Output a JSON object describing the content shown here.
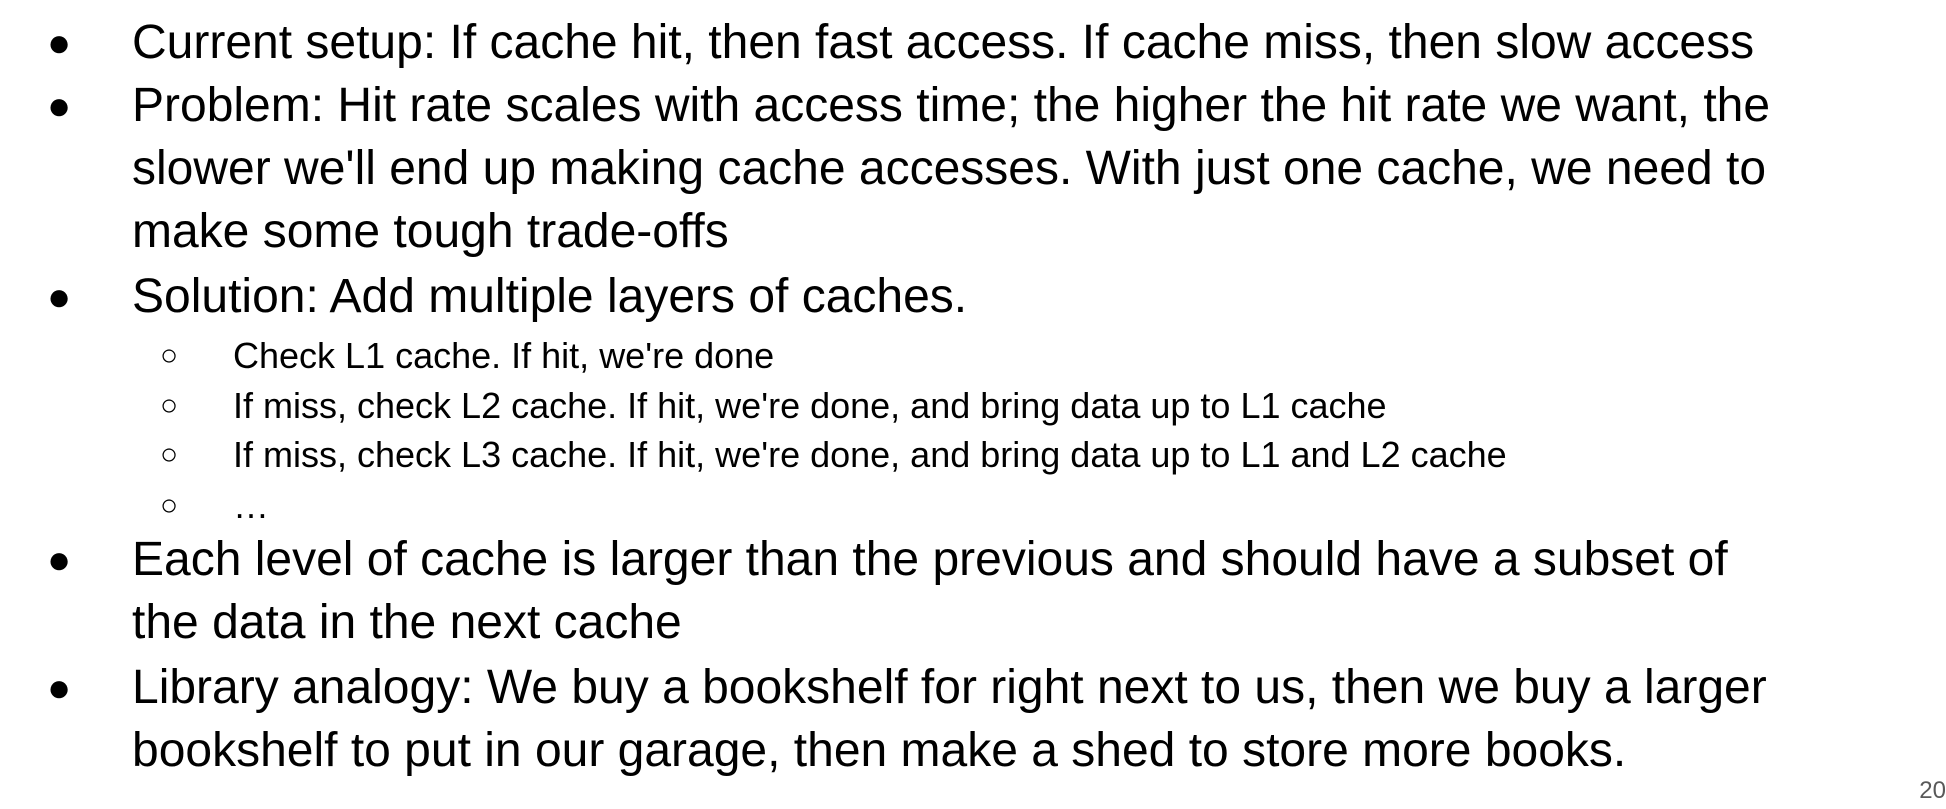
{
  "bullets": {
    "level1": "●",
    "level2": "○"
  },
  "items": [
    {
      "lines": [
        "Current setup: If cache hit, then fast access. If cache miss, then slow access"
      ]
    },
    {
      "lines": [
        "Problem: Hit rate scales with access time; the higher the hit rate we want, the",
        "slower we'll end up making cache accesses. With just one cache, we need to",
        "make some tough trade-offs"
      ]
    },
    {
      "lines": [
        "Solution: Add multiple layers of caches."
      ],
      "subitems": [
        "Check L1 cache. If hit, we're done",
        "If miss, check L2 cache. If hit, we're done, and bring data up to L1 cache",
        "If miss, check L3 cache. If hit, we're done, and bring data up to L1 and L2 cache",
        "…"
      ]
    },
    {
      "lines": [
        "Each level of cache is larger than the previous and should have a subset of",
        "the data in the next cache"
      ]
    },
    {
      "lines": [
        "Library analogy: We buy a bookshelf for right next to us, then we buy a larger",
        "bookshelf to put in our garage, then make a shed to store more books."
      ]
    }
  ],
  "page_number": "20"
}
